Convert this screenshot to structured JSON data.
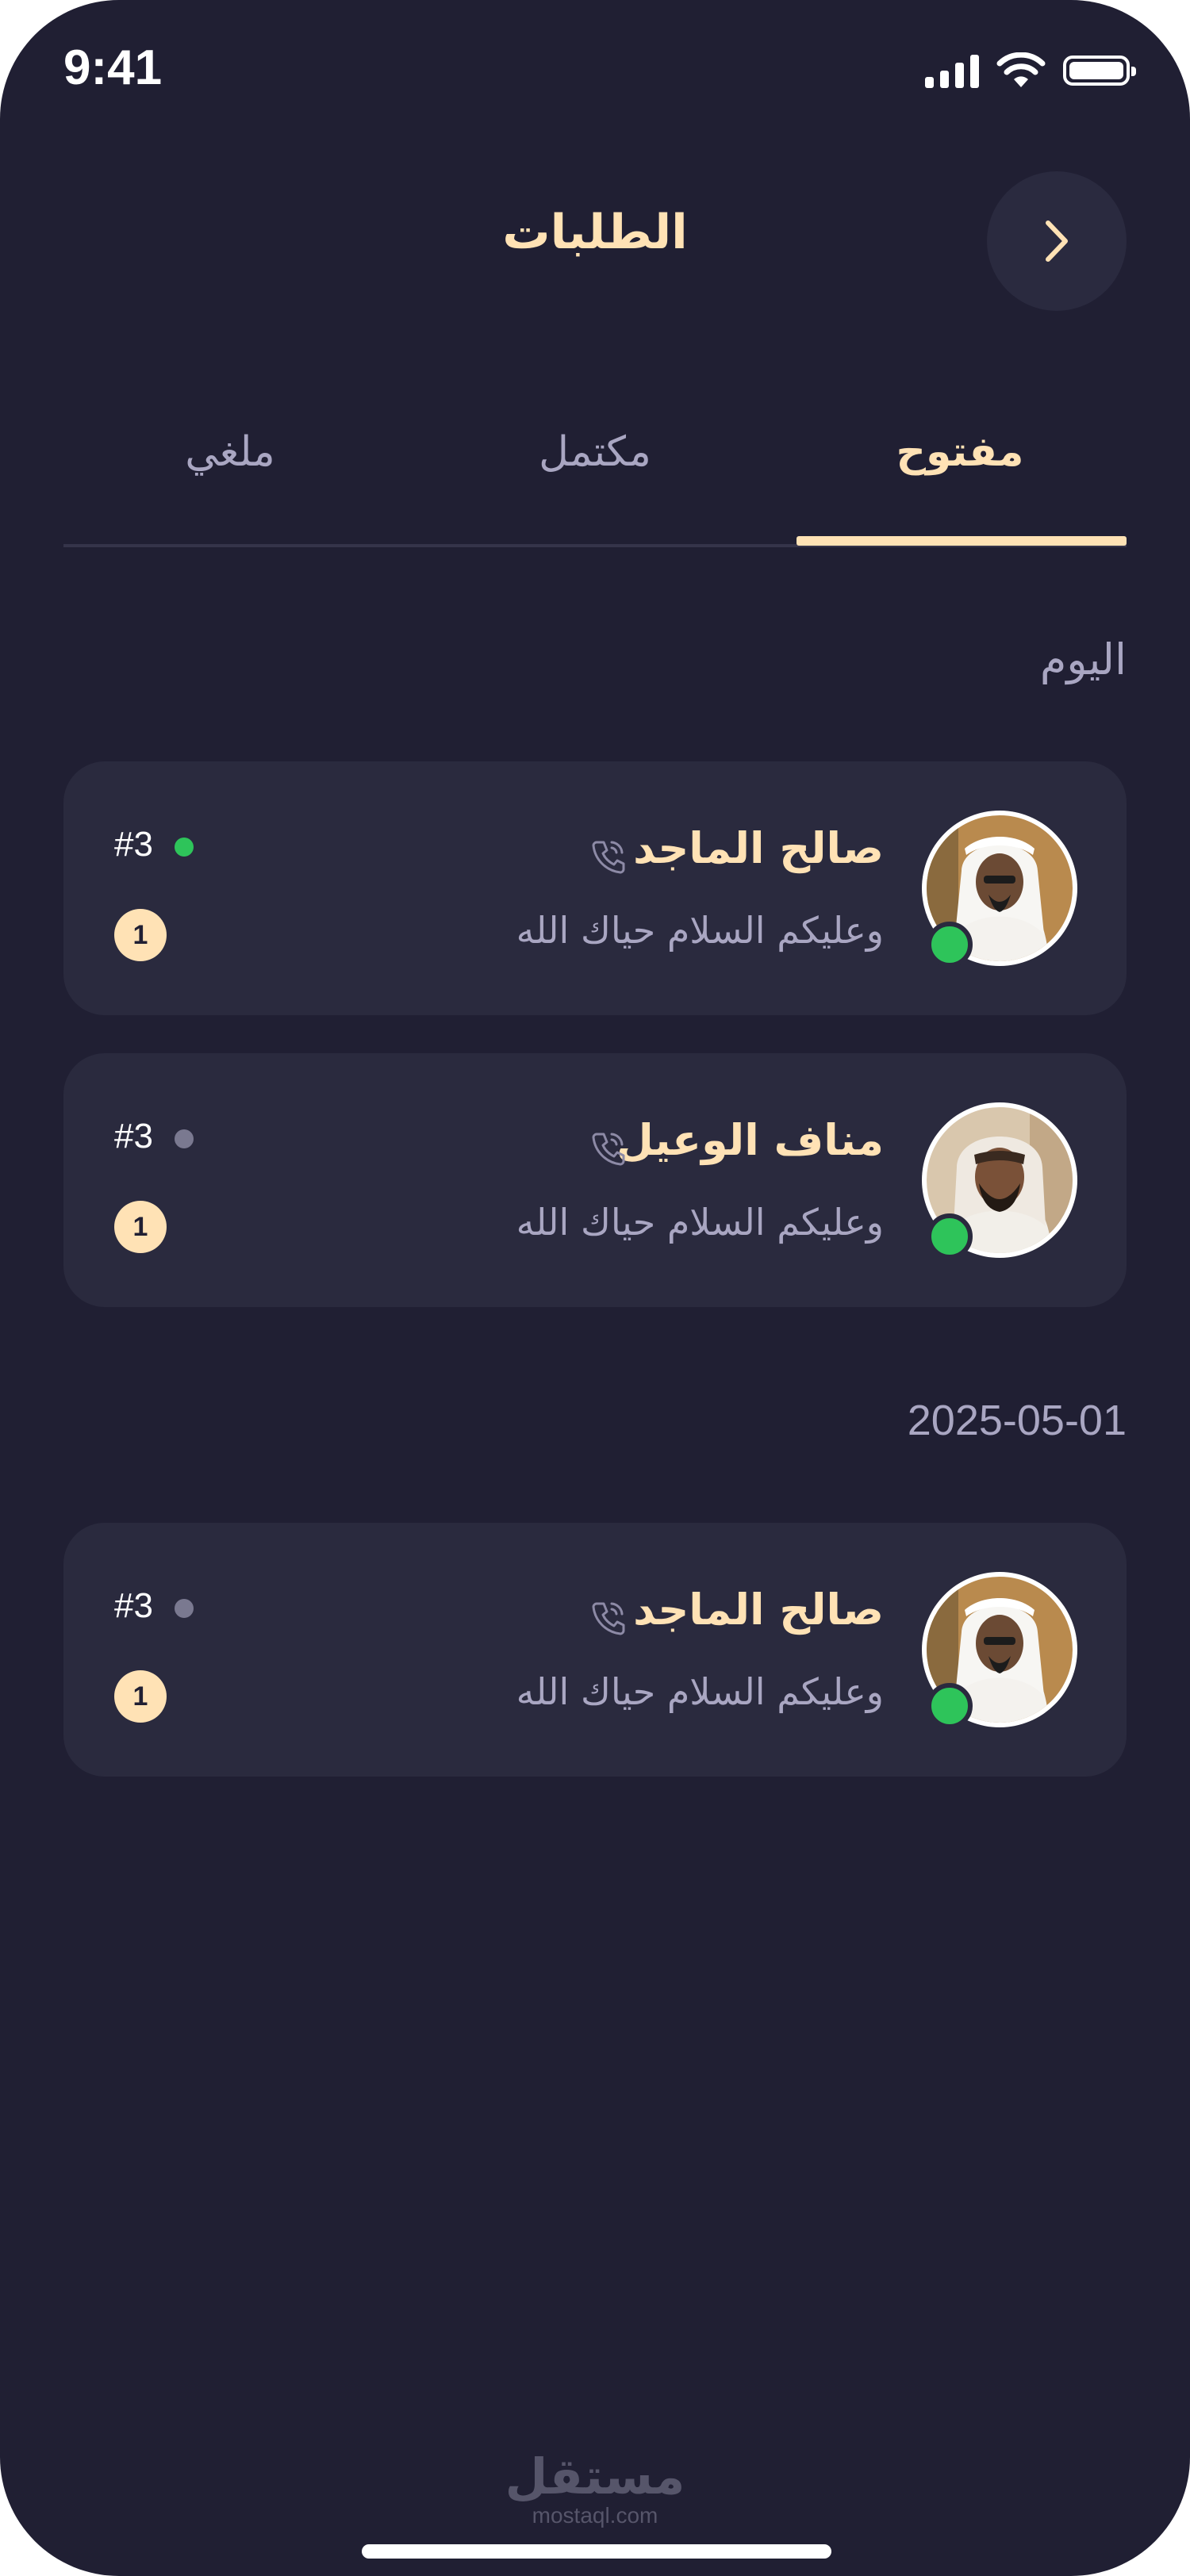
{
  "status_bar": {
    "time": "9:41"
  },
  "header": {
    "title": "الطلبات"
  },
  "tabs": [
    {
      "label": "مفتوح",
      "active": true
    },
    {
      "label": "مكتمل",
      "active": false
    },
    {
      "label": "ملغي",
      "active": false
    }
  ],
  "sections": [
    {
      "heading": "اليوم",
      "items": [
        {
          "name": "صالح الماجد",
          "message": "وعليكم السلام حياك الله",
          "order_number": "#3",
          "status_color": "#2ec45a",
          "unread_count": "1",
          "online": true
        },
        {
          "name": "مناف الوعيل",
          "message": "وعليكم السلام حياك الله",
          "order_number": "#3",
          "status_color": "#7a7990",
          "unread_count": "1",
          "online": true
        }
      ]
    },
    {
      "heading": "2025-05-01",
      "items": [
        {
          "name": "صالح الماجد",
          "message": "وعليكم السلام حياك الله",
          "order_number": "#3",
          "status_color": "#7a7990",
          "unread_count": "1",
          "online": true
        }
      ]
    }
  ],
  "watermark": {
    "arabic": "مستقل",
    "latin": "mostaql.com"
  },
  "colors": {
    "background": "#201f33",
    "card": "#2a2a3e",
    "accent": "#ffe2b5",
    "muted": "#a9a6c2",
    "online": "#2ec45a"
  }
}
